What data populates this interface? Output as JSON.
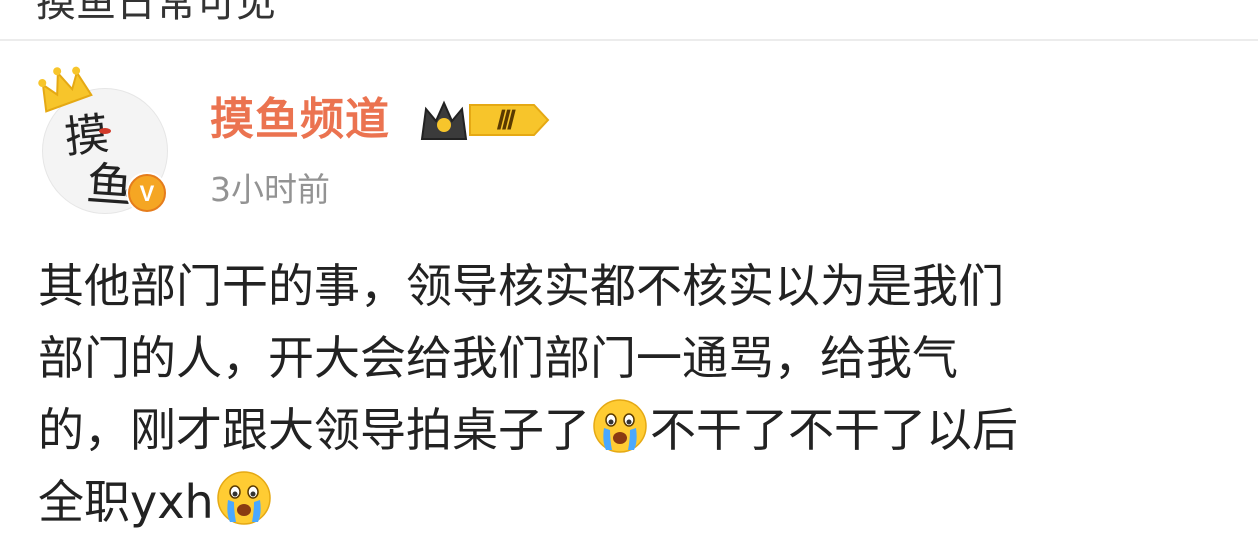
{
  "previous_item": {
    "text": "摸鱼日常可见"
  },
  "post": {
    "author": {
      "name": "摸鱼频道",
      "avatar_text": "摸鱼",
      "level_badge": "Ⅲ",
      "verified_mark": "V"
    },
    "timestamp": "3小时前",
    "lines": [
      [
        "其他部门干的事，领导核实都不核实以为是我们"
      ],
      [
        "部门的人，开大会给我们部门一通骂，给我气"
      ],
      [
        "的，刚才跟大领导拍桌子了",
        "不干了不干了以后"
      ],
      [
        "全职yxh"
      ]
    ],
    "emoji_names": [
      "crying-emoji",
      "crying-emoji"
    ]
  },
  "colors": {
    "username": "#eb7350",
    "timestamp": "#939393",
    "body_text": "#222222",
    "verified_badge": "#f5a623",
    "crown": "#f7c52b"
  }
}
